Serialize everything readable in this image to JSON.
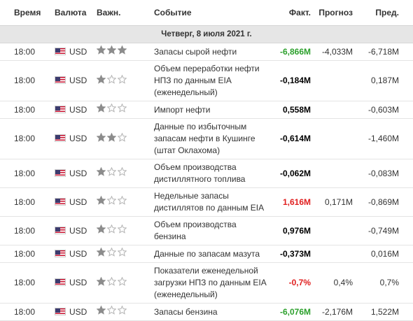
{
  "headers": {
    "time": "Время",
    "currency": "Валюта",
    "importance": "Важн.",
    "event": "Событие",
    "actual": "Факт.",
    "forecast": "Прогноз",
    "previous": "Пред."
  },
  "date_label": "Четверг, 8 июля 2021 г.",
  "colors": {
    "positive": "#2ca02c",
    "negative": "#e02020",
    "neutral": "#000000"
  },
  "events": [
    {
      "time": "18:00",
      "currency": "USD",
      "importance": 3,
      "event": "Запасы сырой нефти",
      "actual": "-6,866M",
      "actual_status": "positive",
      "forecast": "-4,033M",
      "previous": "-6,718M"
    },
    {
      "time": "18:00",
      "currency": "USD",
      "importance": 1,
      "event": "Объем переработки нефти НПЗ по данным EIA (еженедельный)",
      "actual": "-0,184M",
      "actual_status": "neutral",
      "forecast": "",
      "previous": "0,187M"
    },
    {
      "time": "18:00",
      "currency": "USD",
      "importance": 1,
      "event": "Импорт нефти",
      "actual": "0,558M",
      "actual_status": "neutral",
      "forecast": "",
      "previous": "-0,603M"
    },
    {
      "time": "18:00",
      "currency": "USD",
      "importance": 2,
      "event": "Данные по избыточным запасам нефти в Кушинге (штат Оклахома)",
      "actual": "-0,614M",
      "actual_status": "neutral",
      "forecast": "",
      "previous": "-1,460M"
    },
    {
      "time": "18:00",
      "currency": "USD",
      "importance": 1,
      "event": "Объем производства дистиллятного топлива",
      "actual": "-0,062M",
      "actual_status": "neutral",
      "forecast": "",
      "previous": "-0,083M"
    },
    {
      "time": "18:00",
      "currency": "USD",
      "importance": 1,
      "event": "Недельные запасы дистиллятов по данным EIA",
      "actual": "1,616M",
      "actual_status": "negative",
      "forecast": "0,171M",
      "previous": "-0,869M"
    },
    {
      "time": "18:00",
      "currency": "USD",
      "importance": 1,
      "event": "Объем производства бензина",
      "actual": "0,976M",
      "actual_status": "neutral",
      "forecast": "",
      "previous": "-0,749M"
    },
    {
      "time": "18:00",
      "currency": "USD",
      "importance": 1,
      "event": "Данные по запасам мазута",
      "actual": "-0,373M",
      "actual_status": "neutral",
      "forecast": "",
      "previous": "0,016M"
    },
    {
      "time": "18:00",
      "currency": "USD",
      "importance": 1,
      "event": "Показатели еженедельной загрузки НПЗ по данным EIA (еженедельный)",
      "actual": "-0,7%",
      "actual_status": "negative",
      "forecast": "0,4%",
      "previous": "0,7%"
    },
    {
      "time": "18:00",
      "currency": "USD",
      "importance": 1,
      "event": "Запасы бензина",
      "actual": "-6,076M",
      "actual_status": "positive",
      "forecast": "-2,176M",
      "previous": "1,522M"
    }
  ]
}
